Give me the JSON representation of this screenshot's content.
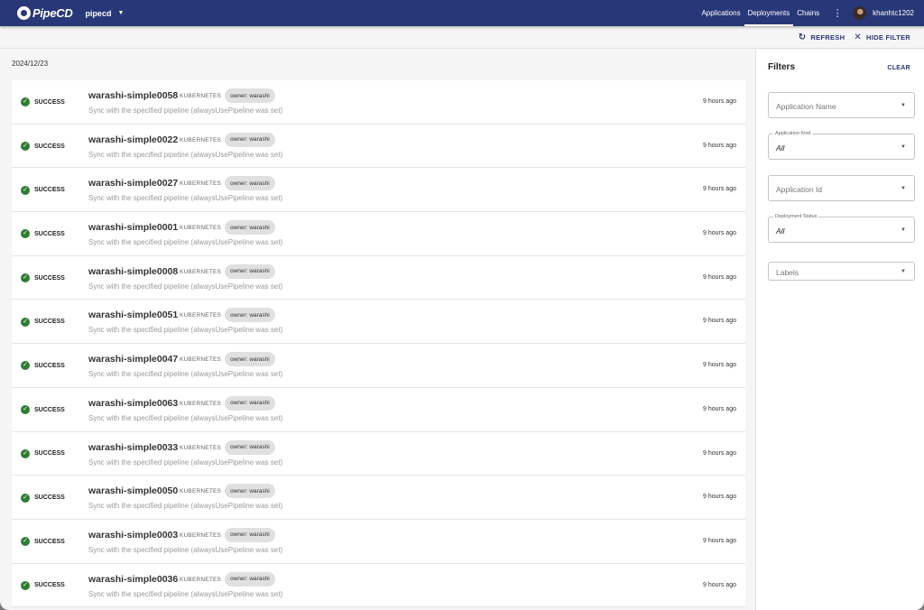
{
  "header": {
    "logo_text": "PipeCD",
    "project": "pipecd",
    "nav": [
      "Applications",
      "Deployments",
      "Chains"
    ],
    "active_nav": "Deployments",
    "username": "khanhtc1202"
  },
  "toolbar": {
    "refresh_label": "REFRESH",
    "hide_filter_label": "HIDE FILTER"
  },
  "list": {
    "date": "2024/12/23",
    "rows": [
      {
        "status": "SUCCESS",
        "name": "warashi-simple0058",
        "kind": "KUBERNETES",
        "label": "owner: warashi",
        "description": "Sync with the specified pipeline (alwaysUsePipeline was set)",
        "time": "9 hours ago"
      },
      {
        "status": "SUCCESS",
        "name": "warashi-simple0022",
        "kind": "KUBERNETES",
        "label": "owner: warashi",
        "description": "Sync with the specified pipeline (alwaysUsePipeline was set)",
        "time": "9 hours ago"
      },
      {
        "status": "SUCCESS",
        "name": "warashi-simple0027",
        "kind": "KUBERNETES",
        "label": "owner: warashi",
        "description": "Sync with the specified pipeline (alwaysUsePipeline was set)",
        "time": "9 hours ago"
      },
      {
        "status": "SUCCESS",
        "name": "warashi-simple0001",
        "kind": "KUBERNETES",
        "label": "owner: warashi",
        "description": "Sync with the specified pipeline (alwaysUsePipeline was set)",
        "time": "9 hours ago"
      },
      {
        "status": "SUCCESS",
        "name": "warashi-simple0008",
        "kind": "KUBERNETES",
        "label": "owner: warashi",
        "description": "Sync with the specified pipeline (alwaysUsePipeline was set)",
        "time": "9 hours ago"
      },
      {
        "status": "SUCCESS",
        "name": "warashi-simple0051",
        "kind": "KUBERNETES",
        "label": "owner: warashi",
        "description": "Sync with the specified pipeline (alwaysUsePipeline was set)",
        "time": "9 hours ago"
      },
      {
        "status": "SUCCESS",
        "name": "warashi-simple0047",
        "kind": "KUBERNETES",
        "label": "owner: warashi",
        "description": "Sync with the specified pipeline (alwaysUsePipeline was set)",
        "time": "9 hours ago"
      },
      {
        "status": "SUCCESS",
        "name": "warashi-simple0063",
        "kind": "KUBERNETES",
        "label": "owner: warashi",
        "description": "Sync with the specified pipeline (alwaysUsePipeline was set)",
        "time": "9 hours ago"
      },
      {
        "status": "SUCCESS",
        "name": "warashi-simple0033",
        "kind": "KUBERNETES",
        "label": "owner: warashi",
        "description": "Sync with the specified pipeline (alwaysUsePipeline was set)",
        "time": "9 hours ago"
      },
      {
        "status": "SUCCESS",
        "name": "warashi-simple0050",
        "kind": "KUBERNETES",
        "label": "owner: warashi",
        "description": "Sync with the specified pipeline (alwaysUsePipeline was set)",
        "time": "9 hours ago"
      },
      {
        "status": "SUCCESS",
        "name": "warashi-simple0003",
        "kind": "KUBERNETES",
        "label": "owner: warashi",
        "description": "Sync with the specified pipeline (alwaysUsePipeline was set)",
        "time": "9 hours ago"
      },
      {
        "status": "SUCCESS",
        "name": "warashi-simple0036",
        "kind": "KUBERNETES",
        "label": "owner: warashi",
        "description": "Sync with the specified pipeline (alwaysUsePipeline was set)",
        "time": "9 hours ago"
      }
    ]
  },
  "filters": {
    "title": "Filters",
    "clear_label": "CLEAR",
    "application_name": {
      "placeholder": "Application Name"
    },
    "application_kind": {
      "label": "Application Kind",
      "value": "All"
    },
    "application_id": {
      "placeholder": "Application Id"
    },
    "deployment_status": {
      "label": "Deployment Status",
      "value": "All"
    },
    "labels": {
      "placeholder": "Labels"
    }
  },
  "colors": {
    "appbar": "#283778",
    "success": "#2e7d32"
  },
  "icons": {
    "refresh": "refresh-icon",
    "close": "close-icon",
    "success": "check-circle-icon",
    "dropdown": "dropdown-arrow-icon"
  }
}
